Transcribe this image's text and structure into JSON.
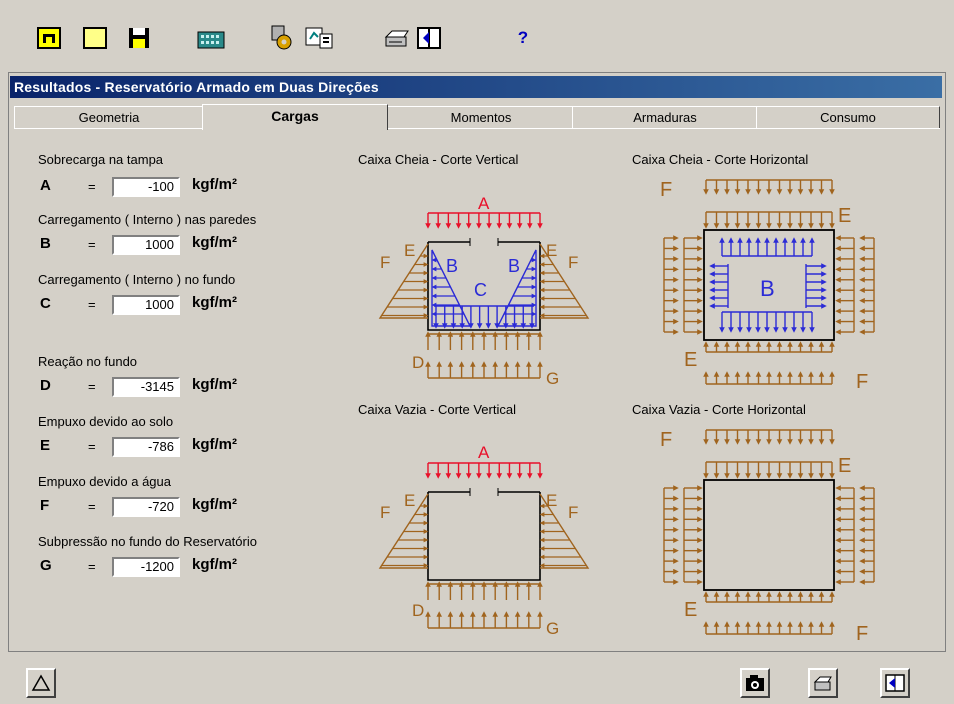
{
  "window": {
    "title": "Resultados - Reservatório Armado em Duas Direções"
  },
  "toolbar": {
    "icons": [
      "new-icon",
      "open-folder-icon",
      "save-icon",
      "calculator-icon",
      "settings-icon",
      "chart-icon",
      "print-icon",
      "exit-icon",
      "help-icon"
    ],
    "help_label": "?"
  },
  "tabs": [
    {
      "label": "Geometria",
      "active": false
    },
    {
      "label": "Cargas",
      "active": true
    },
    {
      "label": "Momentos",
      "active": false
    },
    {
      "label": "Armaduras",
      "active": false
    },
    {
      "label": "Consumo",
      "active": false
    }
  ],
  "loads": {
    "unit": "kgf/m²",
    "items": [
      {
        "label": "Sobrecarga na tampa",
        "letter": "A",
        "value": "-100"
      },
      {
        "label": "Carregamento ( Interno ) nas paredes",
        "letter": "B",
        "value": "1000"
      },
      {
        "label": "Carregamento ( Interno ) no fundo",
        "letter": "C",
        "value": "1000"
      },
      {
        "label": "Reação no fundo",
        "letter": "D",
        "value": "-3145"
      },
      {
        "label": "Empuxo devido ao solo",
        "letter": "E",
        "value": "-786"
      },
      {
        "label": "Empuxo devido a água",
        "letter": "F",
        "value": "-720"
      },
      {
        "label": "Subpressão no fundo do Reservatório",
        "letter": "G",
        "value": "-1200"
      }
    ],
    "eq": "="
  },
  "diagrams": {
    "full_vertical": "Caixa Cheia - Corte Vertical",
    "full_horizontal": "Caixa Cheia - Corte Horizontal",
    "empty_vertical": "Caixa Vazia - Corte Vertical",
    "empty_horizontal": "Caixa Vazia - Corte Horizontal",
    "letters": {
      "A": "A",
      "B": "B",
      "C": "C",
      "D": "D",
      "E": "E",
      "F": "F",
      "G": "G"
    }
  },
  "colors": {
    "red": "#e8102a",
    "brown": "#a0641e",
    "blue": "#2b2bd6",
    "title_bg": "#0a246a"
  }
}
